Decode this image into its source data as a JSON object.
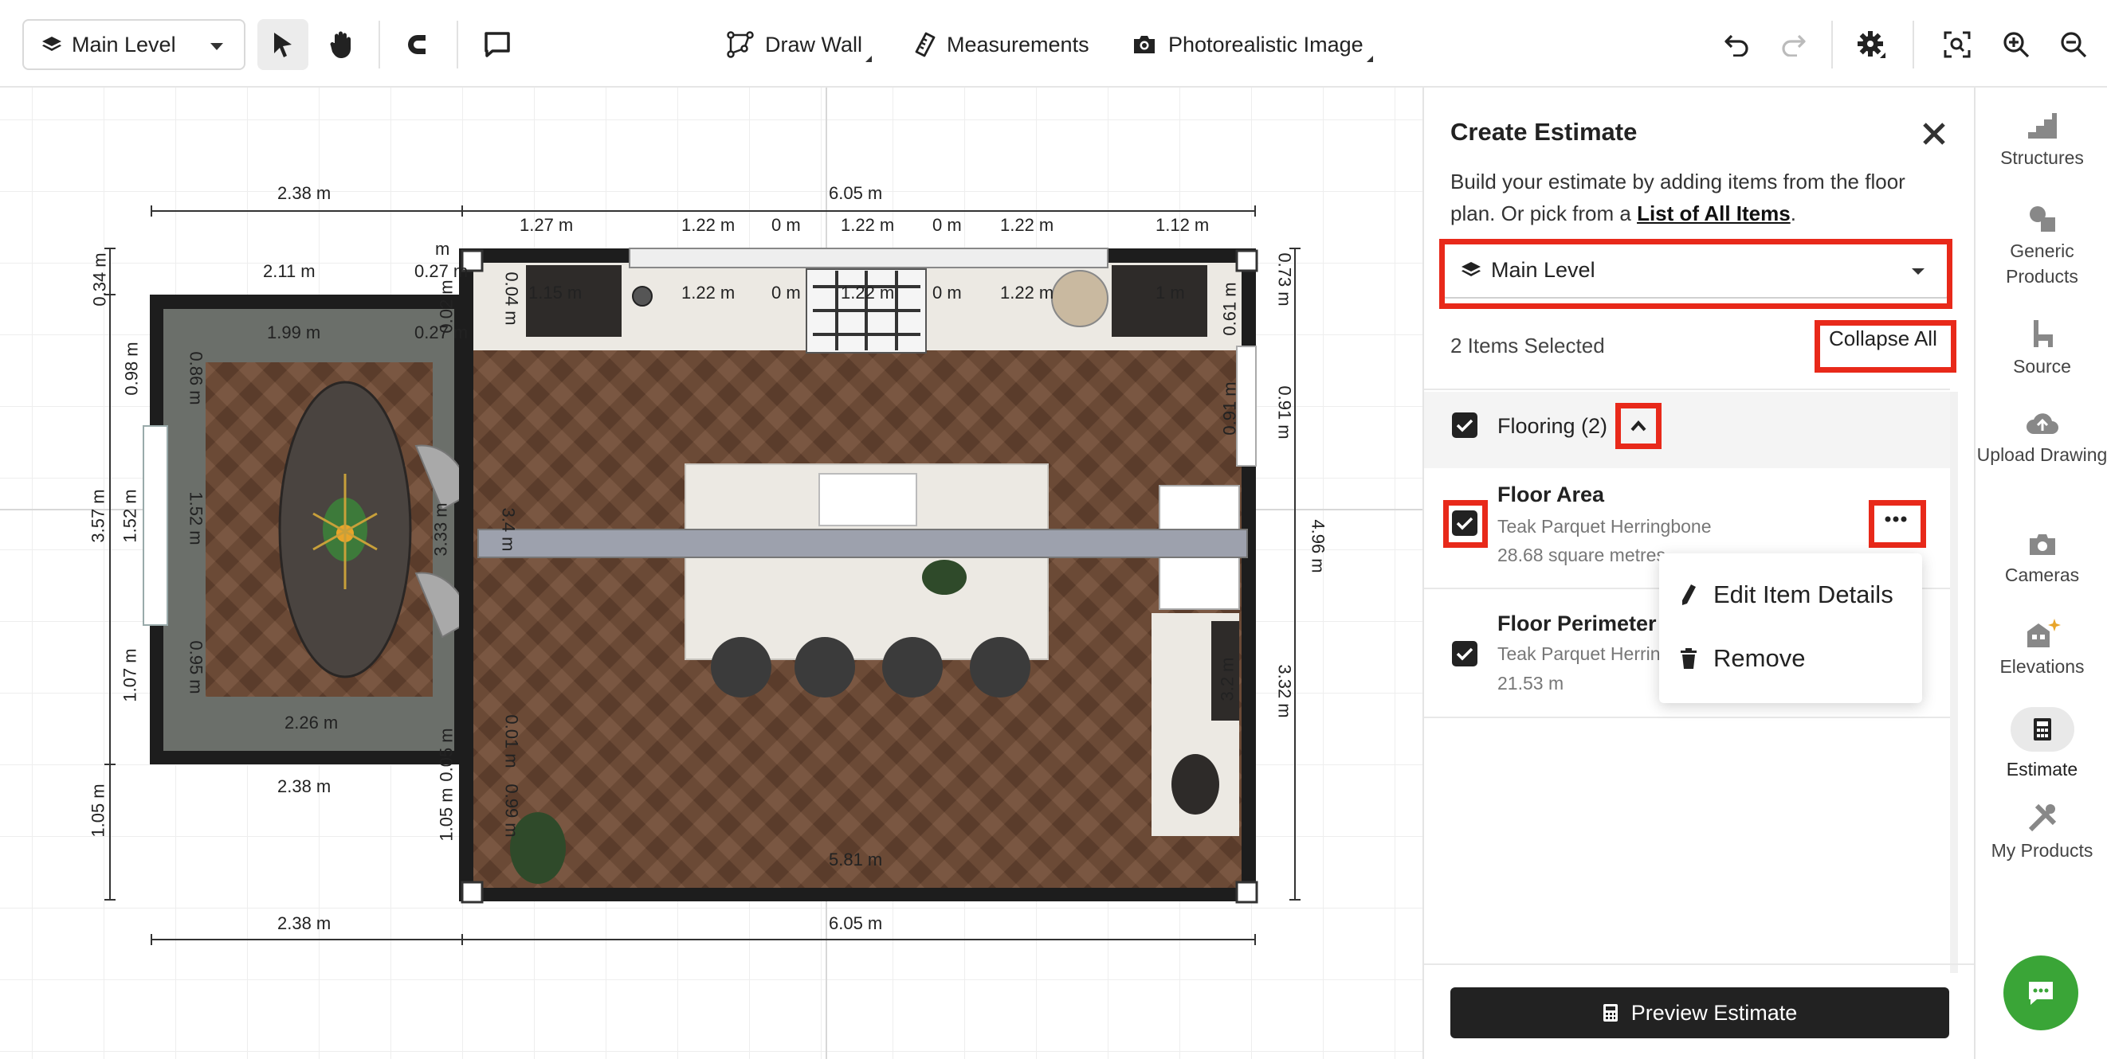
{
  "toolbar": {
    "level_select": "Main Level",
    "draw_wall": "Draw Wall",
    "measurements": "Measurements",
    "photorealistic": "Photorealistic Image"
  },
  "plan": {
    "dims": {
      "top_left_total": "2.38 m",
      "top_right_total": "6.05 m",
      "top_1": "1.27 m",
      "top_2": "1.22 m",
      "top_3": "0 m",
      "top_4": "1.22 m",
      "top_5": "0 m",
      "top_6": "1.22 m",
      "top_7": "1.12 m",
      "in_1": "1.15 m",
      "in_2": "1.22 m",
      "in_3": "0 m",
      "in_4": "1.22 m",
      "in_5": "0 m",
      "in_6": "1.22 m",
      "in_7": "1 m",
      "dining_top": "2.11 m",
      "dining_inner": "1.99 m",
      "dining_0_27a": "0.27 m",
      "dining_0_27b": "0.27 m",
      "dining_bottom_inner": "2.26 m",
      "dining_bottom": "2.38 m",
      "bottom_left": "2.38 m",
      "bottom_right": "6.05 m",
      "kitchen_bottom": "5.81 m",
      "left_0_34": "0.34 m",
      "left_0_98": "0.98 m",
      "left_3_57": "3.57 m",
      "left_1_52a": "1.52 m",
      "left_1_07": "1.07 m",
      "left_1_05": "1.05 m",
      "inner_0_86": "0.86 m",
      "inner_1_52": "1.52 m",
      "inner_0_95": "0.95 m",
      "mid_3_33": "3.33 m",
      "mid_3_4": "3.4 m",
      "mid_0_05": "0.05 m",
      "mid_1_05": "1.05 m",
      "mid_0_01": "0.01 m",
      "mid_0_99": "0.99 m",
      "mid_0_02": "0.02 m",
      "mid_0_04": "0.04 m",
      "mid_m": "m",
      "right_0_73": "0.73 m",
      "right_0_91": "0.91 m",
      "right_4_96": "4.96 m",
      "right_3_32": "3.32 m",
      "right_in_0_61": "0.61 m",
      "right_in_0_91": "0.91 m",
      "right_in_3_2": "3.2 m"
    }
  },
  "panel": {
    "title": "Create Estimate",
    "desc_pre": "Build your estimate by adding items from the floor plan. Or pick from a ",
    "desc_link": "List of All Items",
    "desc_post": ".",
    "level": "Main Level",
    "selected_count": "2 Items Selected",
    "collapse_all": "Collapse All",
    "group_label": "Flooring (2)",
    "items": [
      {
        "name": "Floor Area",
        "material": "Teak Parquet Herringbone",
        "qty": "28.68 square metres"
      },
      {
        "name": "Floor Perimeter",
        "material": "Teak Parquet Herringbone",
        "qty": "21.53 m"
      }
    ],
    "menu": {
      "edit": "Edit Item Details",
      "remove": "Remove"
    },
    "preview_btn": "Preview Estimate"
  },
  "rail": [
    {
      "label": "Structures",
      "icon": "stairs-icon"
    },
    {
      "label": "Generic Products",
      "icon": "shapes-icon"
    },
    {
      "label": "Source",
      "icon": "chair-icon"
    },
    {
      "label": "Upload Drawing",
      "icon": "cloud-upload-icon"
    },
    {
      "label": "Cameras",
      "icon": "camera-icon"
    },
    {
      "label": "Elevations",
      "icon": "elevation-icon"
    },
    {
      "label": "Estimate",
      "icon": "calculator-icon"
    },
    {
      "label": "My Products",
      "icon": "tools-icon"
    }
  ]
}
